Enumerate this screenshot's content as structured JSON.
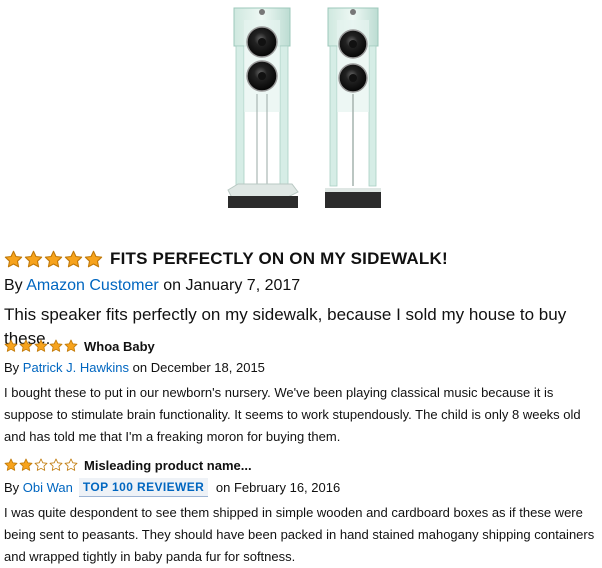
{
  "product": {
    "image_icon": "floor-standing-glass-speakers-image"
  },
  "colors": {
    "star_fill": "#f7a31c",
    "star_stroke": "#c17a0a",
    "link": "#0066c0",
    "text": "#111111"
  },
  "reviews": [
    {
      "rating": 5,
      "title": "FITS PERFECTLY ON ON MY SIDEWALK!",
      "by": "By",
      "author": "Amazon Customer",
      "badge": "",
      "on": "on",
      "date": "January 7, 2017",
      "text": "This speaker fits perfectly on my sidewalk, because I sold my house to buy these."
    },
    {
      "rating": 5,
      "title": "Whoa Baby",
      "by": "By",
      "author": "Patrick J. Hawkins",
      "badge": "",
      "on": "on",
      "date": "December 18, 2015",
      "text": "I bought these to put in our newborn's nursery. We've been playing classical music because it is suppose to stimulate brain functionality. It seems to work stupendously. The child is only 8 weeks old and has told me that I'm a freaking moron for buying them."
    },
    {
      "rating": 2,
      "title": "Misleading product name...",
      "by": "By",
      "author": "Obi Wan",
      "badge": "TOP 100 REVIEWER",
      "on": "on",
      "date": "February 16, 2016",
      "text": "I was quite despondent to see them shipped in simple wooden and cardboard boxes as if these were being sent to peasants. They should have been packed in hand stained mahogany shipping containers and wrapped tightly in baby panda fur for softness."
    }
  ]
}
